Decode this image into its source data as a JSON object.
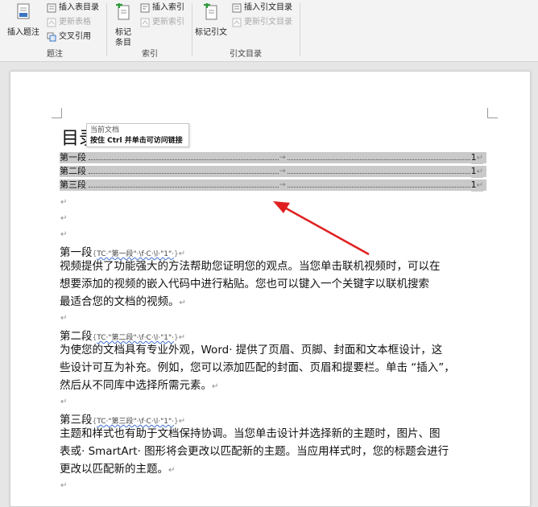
{
  "ribbon": {
    "caption_group": {
      "label": "题注",
      "insert_caption": "插入题注",
      "insert_table_of_figures": "插入表目录",
      "update_table": "更新表格",
      "cross_reference": "交叉引用"
    },
    "index_group": {
      "label": "索引",
      "mark_entry_line1": "标记",
      "mark_entry_line2": "条目",
      "insert_index": "插入索引",
      "update_index": "更新索引"
    },
    "citation_group": {
      "label": "引文目录",
      "mark_citation": "标记引文",
      "insert_table_of_authorities": "插入引文目录",
      "update_table": "更新引文目录"
    }
  },
  "document": {
    "toc_title": "目录",
    "tooltip": {
      "line1": "当前文档",
      "line2": "按住 Ctrl 并单击可访问链接"
    },
    "toc_entries": [
      {
        "label": "第一段",
        "tab": "→",
        "page": "1"
      },
      {
        "label": "第二段",
        "tab": "→",
        "page": "1"
      },
      {
        "label": "第三段",
        "tab": "→",
        "page": "1"
      }
    ],
    "para_mark": "↵",
    "sections": [
      {
        "heading": "第一段",
        "field_open": "{",
        "field_code": "TC·\"第一段\"·\\f·C·\\l·\"1\"·",
        "field_close": "}",
        "lines": [
          "视频提供了功能强大的方法帮助您证明您的观点。当您单击联机视频时，可以在",
          "想要添加的视频的嵌入代码中进行粘贴。您也可以键入一个关键字以联机搜索",
          "最适合您的文档的视频。"
        ]
      },
      {
        "heading": "第二段",
        "field_open": "{",
        "field_code": "TC·\"第二段\"·\\f·C·\\l·\"1\"·",
        "field_close": "}",
        "lines": [
          "为使您的文档具有专业外观，Word· 提供了页眉、页脚、封面和文本框设计，这",
          "些设计可互为补充。例如，您可以添加匹配的封面、页眉和提要栏。单击 “插入”，",
          "然后从不同库中选择所需元素。"
        ]
      },
      {
        "heading": "第三段",
        "field_open": "{",
        "field_code": "TC·\"第三段\"·\\f·C·\\l·\"1\"·",
        "field_close": "}",
        "lines": [
          "主题和样式也有助于文档保持协调。当您单击设计并选择新的主题时，图片、图",
          "表或· SmartArt· 图形将会更改以匹配新的主题。当应用样式时，您的标题会进行",
          "更改以匹配新的主题。"
        ]
      }
    ]
  },
  "colors": {
    "toc_highlight": "#c9c9c9",
    "annotation_arrow": "#e02020",
    "ribbon_bg": "#f3f3f3"
  }
}
